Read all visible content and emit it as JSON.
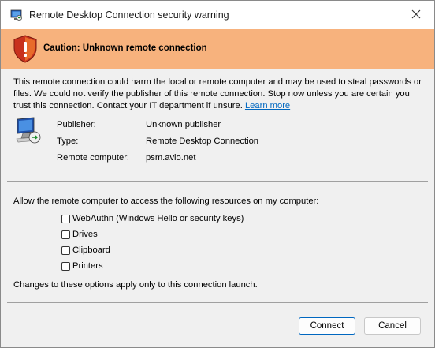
{
  "window": {
    "title": "Remote Desktop Connection security warning",
    "app_icon": "remote-desktop-icon",
    "close_glyph": "✕"
  },
  "banner": {
    "icon": "warning-shield-icon",
    "text": "Caution: Unknown remote connection",
    "color": "#f7b27d"
  },
  "warning": {
    "text": "This remote connection could harm the local or remote computer and may be used to steal passwords or files. We could not verify the publisher of this remote connection. Stop now unless you are certain you trust this connection. Contact your IT department if unsure.",
    "link": "Learn more"
  },
  "details": {
    "icon": "remote-computer-icon",
    "publisher_label": "Publisher:",
    "publisher_value": "Unknown publisher",
    "type_label": "Type:",
    "type_value": "Remote Desktop Connection",
    "remote_label": "Remote computer:",
    "remote_value": "psm.avio.net"
  },
  "resources": {
    "label": "Allow the remote computer to access the following resources on my computer:",
    "options": [
      {
        "label": "WebAuthn (Windows Hello or security keys)",
        "checked": false
      },
      {
        "label": "Drives",
        "checked": false
      },
      {
        "label": "Clipboard",
        "checked": false
      },
      {
        "label": "Printers",
        "checked": false
      }
    ],
    "note": "Changes to these options apply only to this connection launch."
  },
  "buttons": {
    "connect": "Connect",
    "cancel": "Cancel",
    "accent": "#0067c0"
  }
}
